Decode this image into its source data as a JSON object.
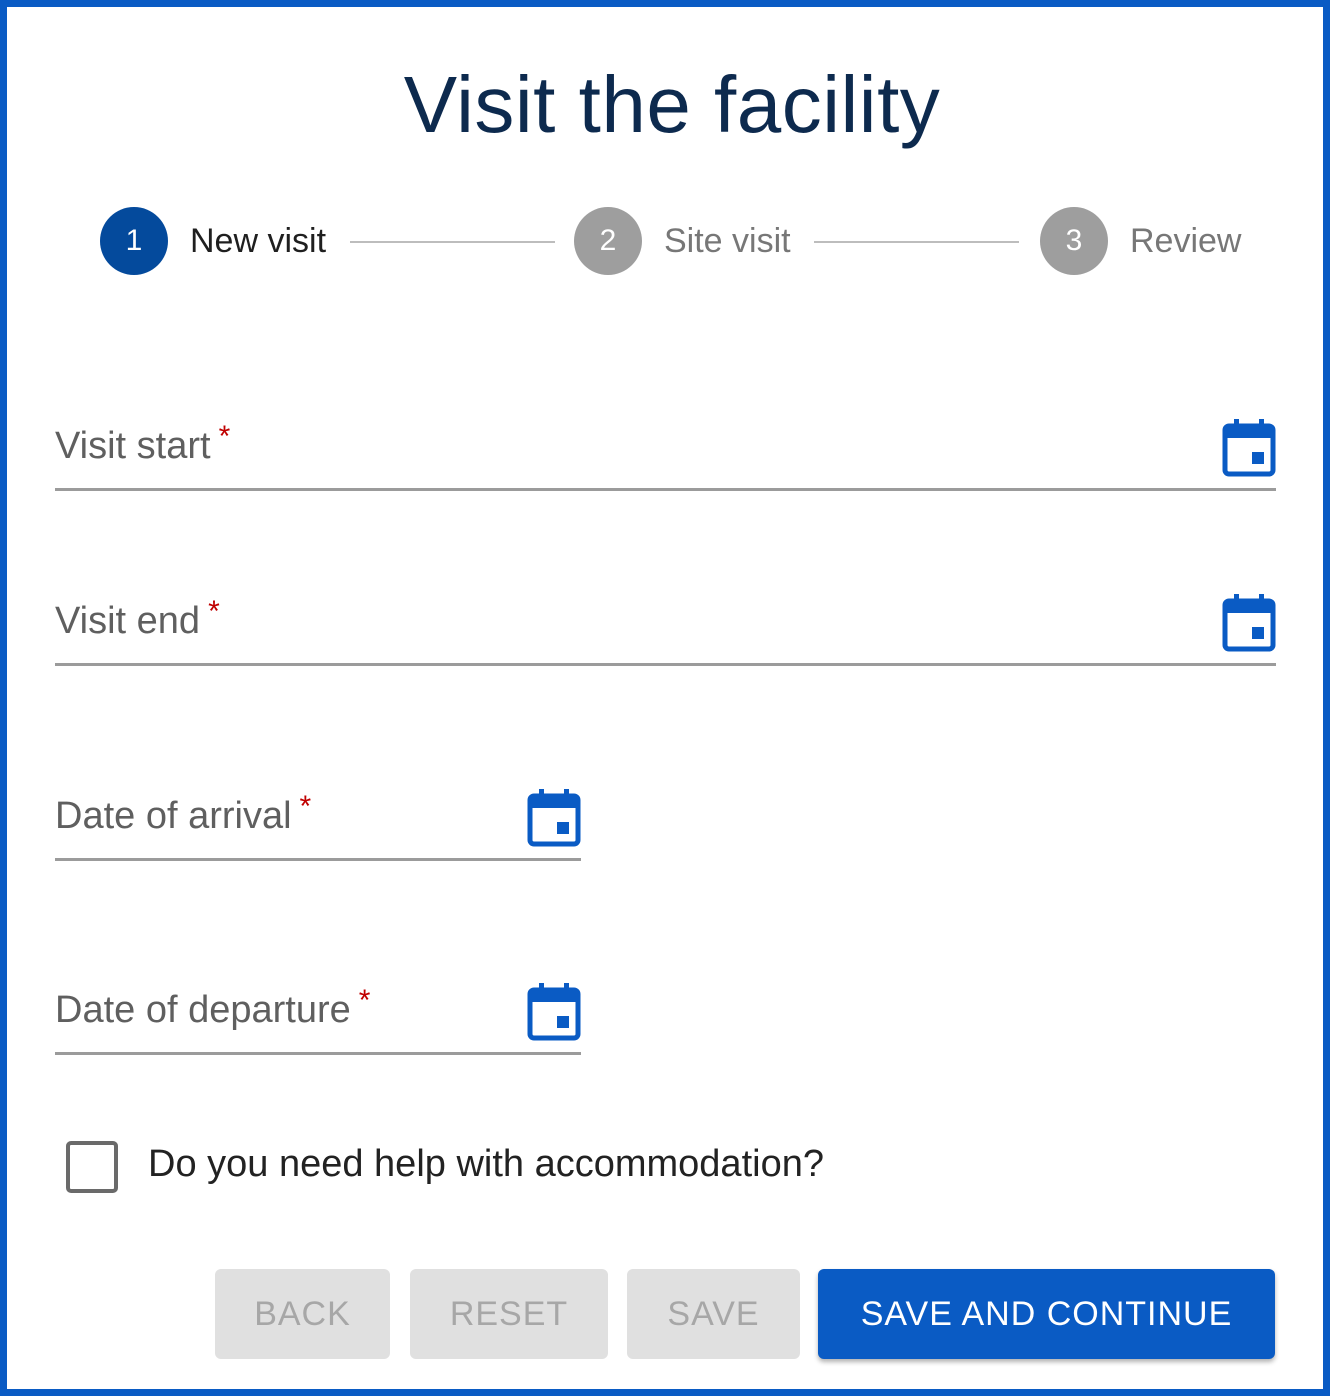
{
  "title": "Visit the facility",
  "stepper": {
    "steps": [
      {
        "number": "1",
        "label": "New visit",
        "state": "active"
      },
      {
        "number": "2",
        "label": "Site visit",
        "state": "inactive"
      },
      {
        "number": "3",
        "label": "Review",
        "state": "inactive"
      }
    ]
  },
  "fields": {
    "visit_start": {
      "label": "Visit start",
      "required_mark": "*",
      "icon": "calendar-icon"
    },
    "visit_end": {
      "label": "Visit end",
      "required_mark": "*",
      "icon": "calendar-icon"
    },
    "date_of_arrival": {
      "label": "Date of arrival",
      "required_mark": "*",
      "icon": "calendar-icon"
    },
    "date_of_departure": {
      "label": "Date of departure",
      "required_mark": "*",
      "icon": "calendar-icon"
    }
  },
  "accommodation": {
    "label": "Do you need help with accommodation?",
    "checked": false
  },
  "buttons": {
    "back": "BACK",
    "reset": "RESET",
    "save": "SAVE",
    "save_and_continue": "SAVE AND CONTINUE"
  },
  "colors": {
    "primary": "#0a5bc4",
    "step_active": "#044a9c",
    "step_inactive": "#9e9e9e",
    "required": "#c00000",
    "title": "#0d2a4e"
  }
}
